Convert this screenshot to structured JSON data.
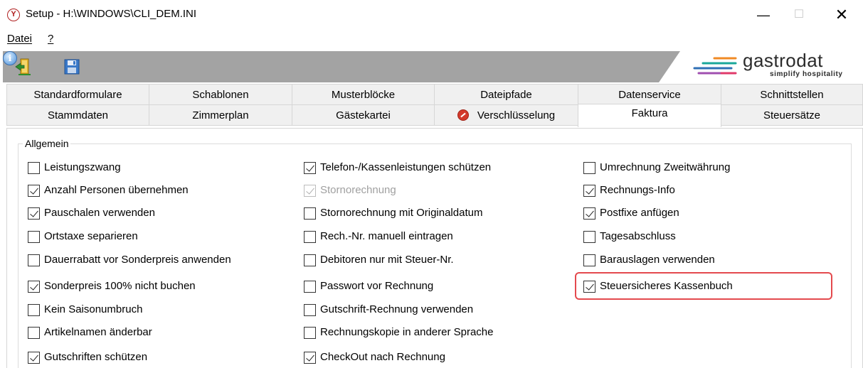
{
  "window": {
    "title": "Setup - H:\\WINDOWS\\CLI_DEM.INI",
    "minimize_glyph": "—",
    "maximize_glyph": "☐",
    "close_glyph": "✕"
  },
  "menubar": {
    "items": [
      {
        "label": "Datei"
      },
      {
        "label": "?"
      }
    ]
  },
  "toolbar": {
    "icons": [
      "exit-door-icon",
      "save-floppy-icon",
      "info-icon"
    ],
    "logo": {
      "text": "gastrodat",
      "tagline": "simplify hospitality"
    }
  },
  "tabs": {
    "row1": [
      "Standardformulare",
      "Schablonen",
      "Musterblöcke",
      "Dateipfade",
      "Datenservice",
      "Schnittstellen"
    ],
    "row2": [
      "Stammdaten",
      "Zimmerplan",
      "Gästekartei",
      "Verschlüsselung",
      "Faktura",
      "Steuersätze"
    ],
    "active": "Faktura"
  },
  "group": {
    "title": "Allgemein",
    "col1": [
      {
        "label": "Leistungszwang",
        "checked": false
      },
      {
        "label": "Anzahl Personen übernehmen",
        "checked": true
      },
      {
        "label": "Pauschalen verwenden",
        "checked": true
      },
      {
        "label": "Ortstaxe separieren",
        "checked": false
      },
      {
        "label": "Dauerrabatt vor Sonderpreis anwenden",
        "checked": false
      },
      {
        "label": "Sonderpreis 100% nicht buchen",
        "checked": true
      },
      {
        "label": "Kein Saisonumbruch",
        "checked": false
      },
      {
        "label": "Artikelnamen änderbar",
        "checked": false
      },
      {
        "label": "Gutschriften schützen",
        "checked": true
      }
    ],
    "col2": [
      {
        "label": "Telefon-/Kassenleistungen schützen",
        "checked": true
      },
      {
        "label": "Stornorechnung",
        "checked": true,
        "disabled": true
      },
      {
        "label": "Stornorechnung mit Originaldatum",
        "checked": false
      },
      {
        "label": "Rech.-Nr. manuell eintragen",
        "checked": false
      },
      {
        "label": "Debitoren nur mit Steuer-Nr.",
        "checked": false
      },
      {
        "label": "Passwort vor Rechnung",
        "checked": false
      },
      {
        "label": "Gutschrift-Rechnung verwenden",
        "checked": false
      },
      {
        "label": "Rechnungskopie in anderer Sprache",
        "checked": false
      },
      {
        "label": "CheckOut nach Rechnung",
        "checked": true
      }
    ],
    "col3": [
      {
        "label": "Umrechnung Zweitwährung",
        "checked": false
      },
      {
        "label": "Rechnungs-Info",
        "checked": true
      },
      {
        "label": "Postfixe anfügen",
        "checked": true
      },
      {
        "label": "Tagesabschluss",
        "checked": false
      },
      {
        "label": "Barauslagen verwenden",
        "checked": false
      },
      {
        "label": "Steuersicheres Kassenbuch",
        "checked": true
      }
    ]
  },
  "colors": {
    "toolbar_bg": "#a3a3a3",
    "highlight": "#e44a4e",
    "logo_lines": [
      "#f08a24",
      "#1aa79a",
      "#2f6fb5",
      "#a04fb0",
      "#e03a6a"
    ]
  }
}
